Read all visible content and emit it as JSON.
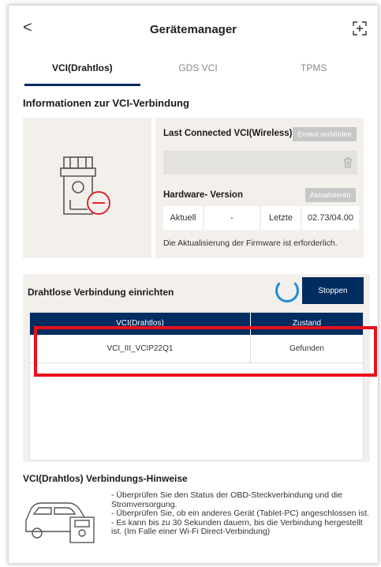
{
  "header": {
    "title": "Gerätemanager",
    "back": "<"
  },
  "tabs": [
    {
      "label": "VCI(Drahtlos)",
      "active": true
    },
    {
      "label": "GDS VCI",
      "active": false
    },
    {
      "label": "TPMS",
      "active": false
    }
  ],
  "connection": {
    "section_title": "Informationen zur VCI-Verbindung",
    "last_connected_label": "Last Connected VCI(Wireless)",
    "reconnect_label": "Erneut verbinden",
    "last_connected_value": "",
    "hardware_label": "Hardware- Version",
    "update_label": "Aktualisieren",
    "current_label": "Aktuell",
    "current_value": "-",
    "latest_label": "Letzte",
    "latest_value": "02.73/04.00",
    "note": "Die Aktualisierung der Firmware ist erforderlich."
  },
  "wireless_setup": {
    "title": "Drahtlose Verbindung einrichten",
    "stop_label": "Stoppen",
    "columns": [
      "VCI(Drahtlos)",
      "Zustand"
    ],
    "rows": [
      {
        "vci": "VCI_III_VCIP22Q1",
        "status": "Gefunden"
      }
    ]
  },
  "hints": {
    "title": "VCI(Drahtlos) Verbindungs-Hinweise",
    "items": [
      "- Überprüfen Sie den Status der OBD-Steckverbindung und die Stromversorgung.",
      "- Überprüfen Sie, ob ein anderes Gerät (Tablet-PC) angeschlossen ist.",
      "- Es kann bis zu 30 Sekunden dauern, bis die Verbindung hergestellt ist. (Im Falle einer Wi-Fi Direct-Verbindung)"
    ]
  },
  "colors": {
    "accent": "#002c5f",
    "highlight": "#e8101a",
    "panel": "#f3efeb",
    "disabled": "#c7c7c7",
    "spinner": "#1a8ddb"
  }
}
